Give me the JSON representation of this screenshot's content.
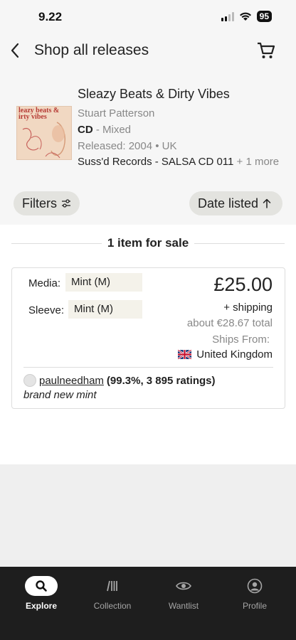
{
  "status_bar": {
    "time": "9.22",
    "battery": "95",
    "icons": [
      "signal-icon",
      "wifi-icon",
      "battery-icon"
    ]
  },
  "header": {
    "title": "Shop all releases",
    "back_icon": "chevron-left-icon",
    "cart_icon": "shopping-cart-icon"
  },
  "release": {
    "title": "Sleazy Beats & Dirty Vibes",
    "artist": "Stuart Patterson",
    "format": "CD",
    "format_separator": " - ",
    "format_detail": "Mixed",
    "released": "Released: 2004 • UK",
    "label": "Suss'd Records - SALSA CD 011",
    "label_more": "+ 1 more",
    "cover_text": "leazy beats & irty vibes"
  },
  "controls": {
    "filters_label": "Filters",
    "filters_icon": "sliders-icon",
    "sort_label": "Date listed",
    "sort_icon": "arrow-up-icon"
  },
  "listings_header": "1 item for sale",
  "listing": {
    "media_label": "Media:",
    "media_value": "Mint (M)",
    "sleeve_label": "Sleeve:",
    "sleeve_value": "Mint (M)",
    "price": "£25.00",
    "shipping": "+  shipping",
    "total": "about €28.67 total",
    "ships_from_label": "Ships From:",
    "ships_from_flag": "🇬🇧",
    "ships_from_country": "United Kingdom",
    "seller_name": "paulneedham",
    "seller_stats": "(99.3%, 3 895 ratings)",
    "comment": "brand new  mint"
  },
  "bottom_nav": {
    "items": [
      {
        "label": "Explore",
        "icon": "search-icon",
        "active": true
      },
      {
        "label": "Collection",
        "icon": "collection-icon",
        "active": false
      },
      {
        "label": "Wantlist",
        "icon": "eye-icon",
        "active": false
      },
      {
        "label": "Profile",
        "icon": "profile-icon",
        "active": false
      }
    ]
  },
  "colors": {
    "background": "#efefef",
    "header_bg": "#f6f6f6",
    "pill_bg": "#e3e3df",
    "nav_bg": "#1e1e1e",
    "muted_text": "#888888"
  }
}
